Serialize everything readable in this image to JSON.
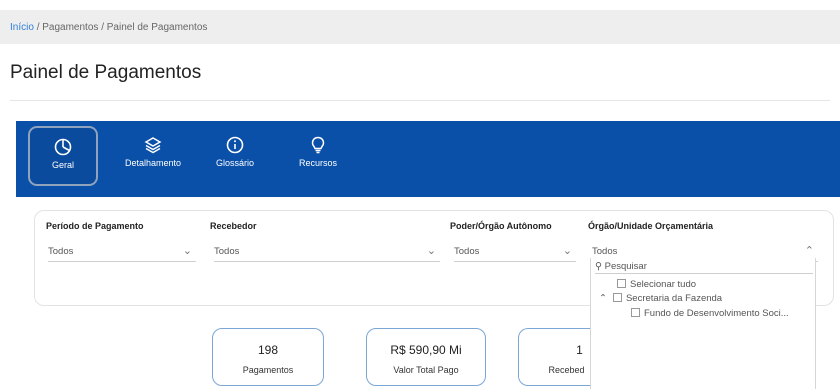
{
  "breadcrumb": {
    "home": "Início",
    "sep1": "/",
    "mid": "Pagamentos",
    "sep2": "/",
    "current": "Painel de Pagamentos"
  },
  "page": {
    "title": "Painel de Pagamentos"
  },
  "nav": {
    "items": [
      {
        "label": "Geral",
        "icon": "pie-chart-icon",
        "active": true
      },
      {
        "label": "Detalhamento",
        "icon": "layers-icon",
        "active": false
      },
      {
        "label": "Glossário",
        "icon": "info-icon",
        "active": false
      },
      {
        "label": "Recursos",
        "icon": "lightbulb-icon",
        "active": false
      }
    ]
  },
  "filters": [
    {
      "label": "Período de Pagamento",
      "value": "Todos"
    },
    {
      "label": "Recebedor",
      "value": "Todos"
    },
    {
      "label": "Poder/Órgão Autônomo",
      "value": "Todos"
    },
    {
      "label": "Órgão/Unidade Orçamentária",
      "value": "Todos"
    }
  ],
  "dropdown": {
    "search_placeholder": "Pesquisar",
    "select_all": "Selecionar tudo",
    "group": "Secretaria da Fazenda",
    "child": "Fundo de Desenvolvimento Soci..."
  },
  "cards": [
    {
      "value": "198",
      "caption": "Pagamentos"
    },
    {
      "value": "R$ 590,90 Mi",
      "caption": "Valor Total Pago"
    },
    {
      "value": "1",
      "caption": "Recebed"
    }
  ],
  "colors": {
    "nav_blue": "#0a50a8",
    "link_blue": "#2f7fd8",
    "card_border": "#7aa7d6"
  }
}
